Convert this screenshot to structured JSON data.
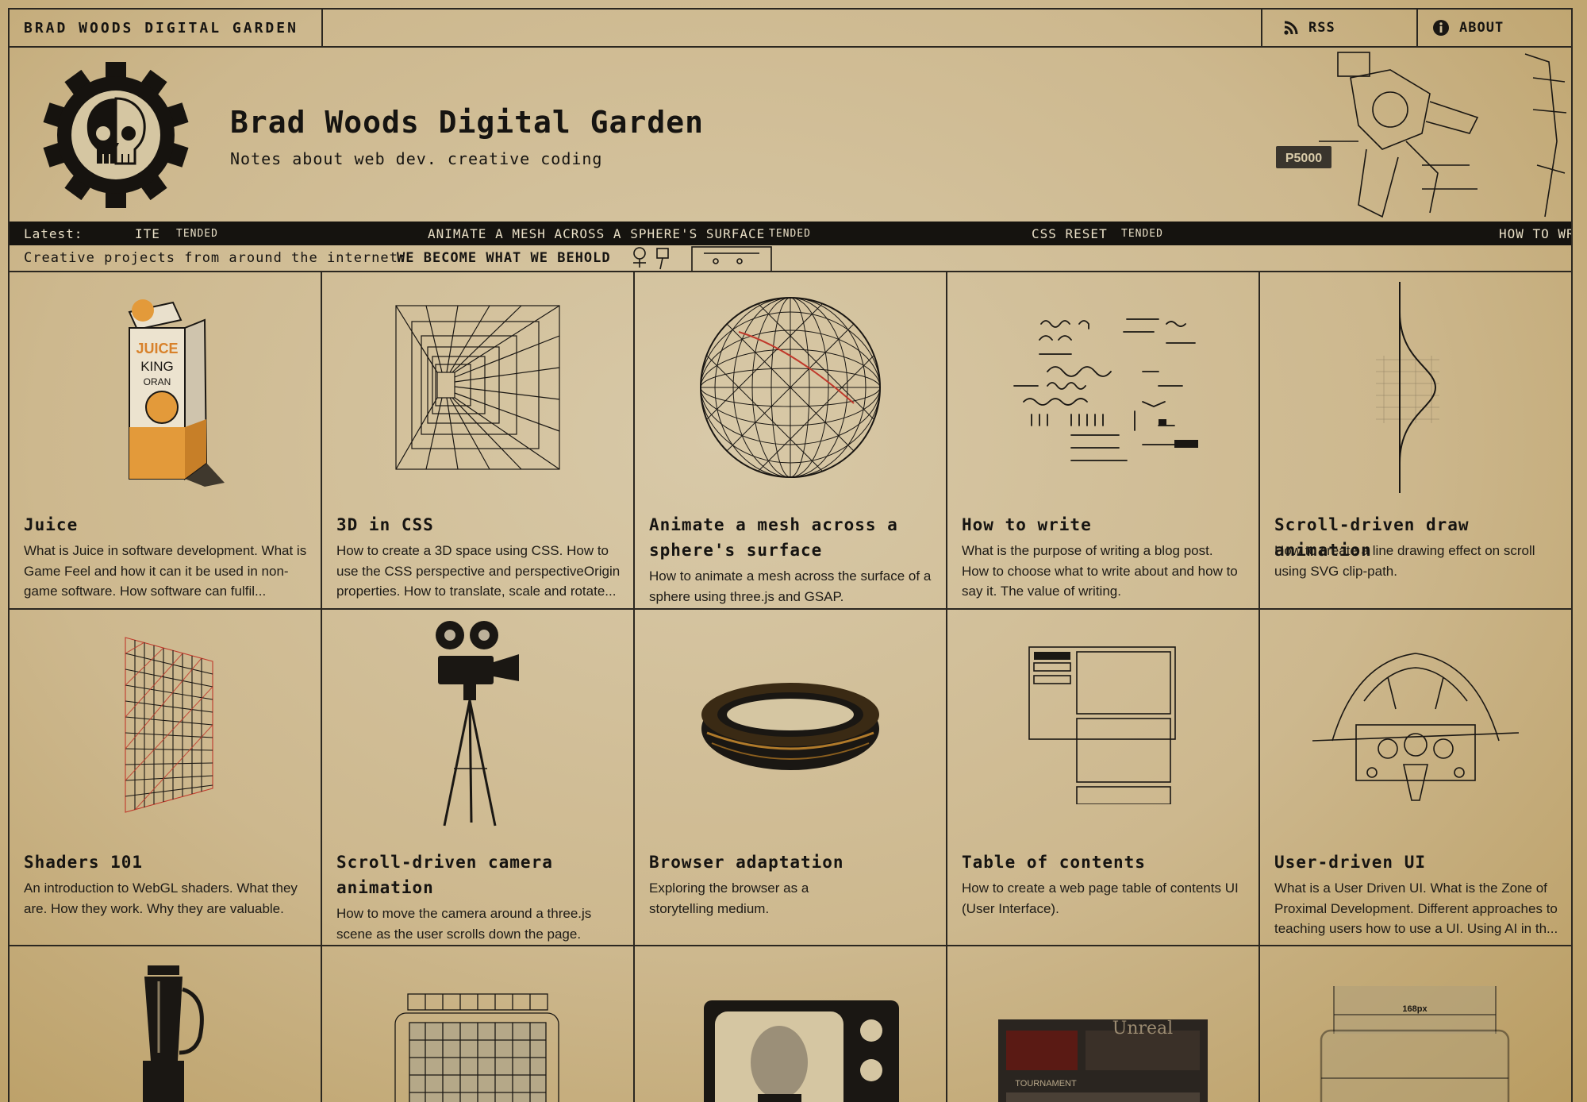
{
  "nav": {
    "brand": "BRAD WOODS DIGITAL GARDEN",
    "rss_label": "RSS",
    "about_label": "ABOUT"
  },
  "header": {
    "title": "Brad Woods Digital Garden",
    "subtitle": "Notes about web dev. creative coding",
    "badge": "P5000"
  },
  "latest": {
    "label": "Latest:",
    "items": [
      {
        "title": "ITE",
        "tag": "TENDED"
      },
      {
        "title": "ANIMATE A MESH ACROSS A SPHERE'S SURFACE",
        "tag": "TENDED"
      },
      {
        "title": "CSS RESET",
        "tag": "TENDED"
      },
      {
        "title": "HOW TO WR",
        "tag": ""
      }
    ]
  },
  "creative": {
    "label": "Creative projects from around the internet:",
    "value": "WE BECOME WHAT WE BEHOLD"
  },
  "cards": [
    {
      "title": "Juice",
      "desc": [
        "What is Juice in software development. What is",
        "Game Feel and how it can it be used in non-",
        "game software. How software can fulfil..."
      ],
      "art": "juice-carton-icon",
      "carton_text": [
        "JUICE",
        "KING",
        "ORAN"
      ]
    },
    {
      "title": "3D in CSS",
      "desc": [
        "How to create a 3D space using CSS. How to",
        "use the CSS perspective and perspectiveOrigin",
        "properties. How to translate, scale and rotate..."
      ],
      "art": "perspective-grid-icon"
    },
    {
      "title": "Animate a mesh across a sphere's surface",
      "title_lines": [
        "Animate a mesh across a",
        "sphere's surface"
      ],
      "desc": [
        "How to animate a mesh across the surface of a",
        "sphere using three.js and GSAP."
      ],
      "art": "wireframe-sphere-icon"
    },
    {
      "title": "How to write",
      "desc": [
        "What is the purpose of writing a blog post.",
        "How to choose what to write about and how to",
        "say it. The value of writing."
      ],
      "art": "handwriting-glyphs-icon"
    },
    {
      "title": "Scroll-driven draw animation",
      "desc": [
        "How to create a line drawing effect on scroll",
        "using SVG clip-path."
      ],
      "art": "bell-curve-icon"
    },
    {
      "title": "Shaders 101",
      "desc": [
        "An introduction to WebGL shaders. What they",
        "are. How they work. Why they are valuable."
      ],
      "art": "shader-grid-icon"
    },
    {
      "title": "Scroll-driven camera animation",
      "title_lines": [
        "Scroll-driven camera",
        "animation"
      ],
      "desc": [
        "How to move the camera around a three.js",
        "scene as the user scrolls down the page."
      ],
      "art": "film-camera-icon"
    },
    {
      "title": "Browser adaptation",
      "desc": [
        "Exploring the browser as a",
        "storytelling medium."
      ],
      "art": "ring-icon"
    },
    {
      "title": "Table of contents",
      "desc": [
        "How to create a web page table of contents UI",
        "(User Interface)."
      ],
      "art": "table-of-contents-icon"
    },
    {
      "title": "User-driven UI",
      "desc": [
        "What is a User Driven UI. What is the Zone of",
        "Proximal Development. Different approaches to",
        "teaching users how to use a UI. Using AI in th..."
      ],
      "art": "cockpit-icon"
    },
    {
      "title": "",
      "desc": [],
      "art": "blender-icon"
    },
    {
      "title": "",
      "desc": [],
      "art": "keyboard-grid-icon"
    },
    {
      "title": "",
      "desc": [],
      "art": "television-icon"
    },
    {
      "title": "",
      "desc": [],
      "art": "retro-game-screen-icon",
      "screen_text": [
        "Unreal",
        "TOURNAMENT"
      ]
    },
    {
      "title": "",
      "desc": [],
      "art": "dimension-box-icon",
      "dimension_text": "168px"
    }
  ]
}
